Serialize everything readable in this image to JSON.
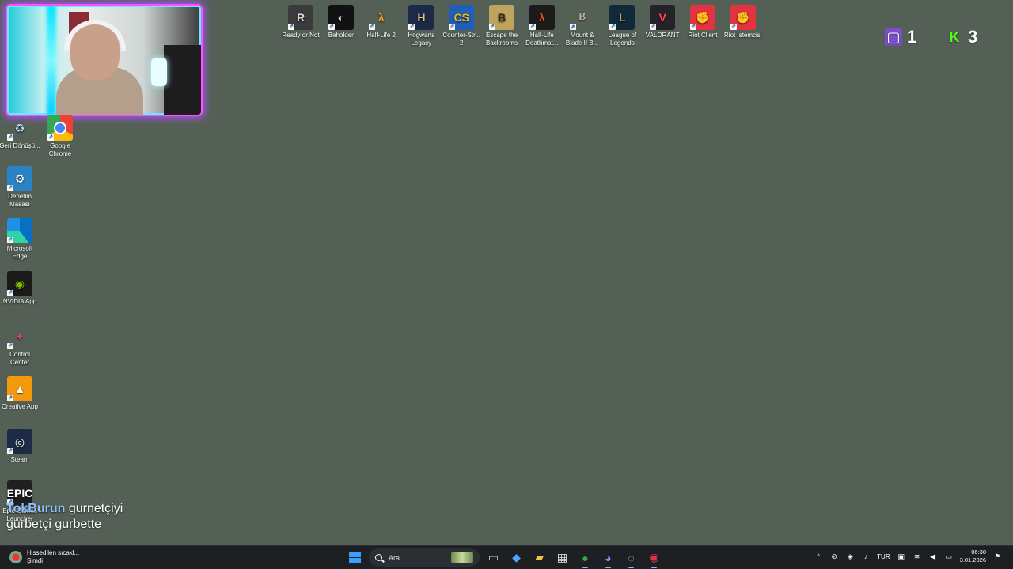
{
  "top_icons": [
    {
      "label": "Ready or Not",
      "glyph": "R",
      "icon": "ready-or-not-icon",
      "style": "i-ron"
    },
    {
      "label": "Beholder",
      "glyph": "◐",
      "icon": "beholder-icon",
      "style": "i-beh"
    },
    {
      "label": "Half-Life 2",
      "glyph": "λ",
      "icon": "half-life-2-icon",
      "style": "i-hl2"
    },
    {
      "label": "Hogwarts Legacy",
      "glyph": "H",
      "icon": "hogwarts-legacy-icon",
      "style": "i-hog"
    },
    {
      "label": "Counter-Str... 2",
      "glyph": "CS",
      "icon": "counter-strike-2-icon",
      "style": "i-cs2"
    },
    {
      "label": "Escape the Backrooms",
      "glyph": "B",
      "icon": "escape-the-backrooms-icon",
      "style": "i-esc"
    },
    {
      "label": "Half-Life Deathmat...",
      "glyph": "λ",
      "icon": "half-life-deathmatch-icon",
      "style": "i-hld"
    },
    {
      "label": "Mount & Blade II B...",
      "glyph": "B",
      "icon": "mount-and-blade-icon",
      "style": "i-mnb"
    },
    {
      "label": "League of Legends",
      "glyph": "L",
      "icon": "league-of-legends-icon",
      "style": "i-lol"
    },
    {
      "label": "VALORANT",
      "glyph": "V",
      "icon": "valorant-icon",
      "style": "i-val"
    },
    {
      "label": "Riot Client",
      "glyph": "✊",
      "icon": "riot-client-icon",
      "style": "i-riot"
    },
    {
      "label": "Riot İstemcisi",
      "glyph": "✊",
      "icon": "riot-istemcisi-icon",
      "style": "i-riot"
    }
  ],
  "left_icons": [
    {
      "label": "Geri Dönüşü...",
      "glyph": "♻",
      "icon": "recycle-bin-icon",
      "style": "i-bin"
    },
    {
      "label": "Google Chrome",
      "glyph": "",
      "icon": "chrome-icon",
      "style": "i-chr"
    },
    {
      "label": "Denetim Masası",
      "glyph": "⚙",
      "icon": "control-panel-icon",
      "style": "i-ctl"
    },
    {
      "label": "Microsoft Edge",
      "glyph": "",
      "icon": "edge-icon",
      "style": "i-edge"
    },
    {
      "label": "NVIDIA App",
      "glyph": "◉",
      "icon": "nvidia-icon",
      "style": "i-nv"
    },
    {
      "label": "Control Center",
      "glyph": "✦",
      "icon": "control-center-icon",
      "style": "i-cc"
    },
    {
      "label": "Creative App",
      "glyph": "▲",
      "icon": "creative-app-icon",
      "style": "i-ca"
    },
    {
      "label": "Steam",
      "glyph": "◎",
      "icon": "steam-icon",
      "style": "i-steam"
    },
    {
      "label": "Epic Games Launcher",
      "glyph": "EPIC",
      "icon": "epic-games-icon",
      "style": "i-epic"
    }
  ],
  "overlay": {
    "twitch_count": "1",
    "kick_count": "3",
    "kick_glyph": "K"
  },
  "chat": {
    "username": "TokBurun",
    "message_line1": "gurnetçiyi",
    "message_line2": "gurbetçi gurbette"
  },
  "taskbar": {
    "weather_title": "Hissedilen sıcakl...",
    "weather_sub": "Şimdi",
    "search_placeholder": "Ara",
    "language": "TUR",
    "time": "06:30",
    "date": "3.01.2026",
    "apps": [
      {
        "icon": "task-view-icon",
        "glyph": "▭",
        "color": "#cfd3d8",
        "active": false
      },
      {
        "icon": "copilot-icon",
        "glyph": "◆",
        "color": "#4fa3ff",
        "active": false
      },
      {
        "icon": "file-explorer-icon",
        "glyph": "▰",
        "color": "#f6c343",
        "active": false
      },
      {
        "icon": "microsoft-store-icon",
        "glyph": "▦",
        "color": "#eaeaea",
        "active": false
      },
      {
        "icon": "chrome-taskbar-icon",
        "glyph": "●",
        "color": "#34a853",
        "active": true
      },
      {
        "icon": "chat-app-icon",
        "glyph": "◕",
        "color": "#a98cff",
        "active": true
      },
      {
        "icon": "obs-icon",
        "glyph": "◌",
        "color": "#dcdcdc",
        "active": true
      },
      {
        "icon": "red-app-icon",
        "glyph": "◉",
        "color": "#e6324b",
        "active": true
      }
    ],
    "tray": [
      {
        "icon": "chevron-up-icon",
        "glyph": "^"
      },
      {
        "icon": "network-off-icon",
        "glyph": "⊘"
      },
      {
        "icon": "security-icon",
        "glyph": "◈"
      },
      {
        "icon": "microphone-icon",
        "glyph": "♪"
      }
    ],
    "tray_right": [
      {
        "icon": "display-icon",
        "glyph": "▣"
      },
      {
        "icon": "wifi-icon",
        "glyph": "≋"
      },
      {
        "icon": "volume-icon",
        "glyph": "◀"
      },
      {
        "icon": "battery-icon",
        "glyph": "▭"
      }
    ]
  }
}
